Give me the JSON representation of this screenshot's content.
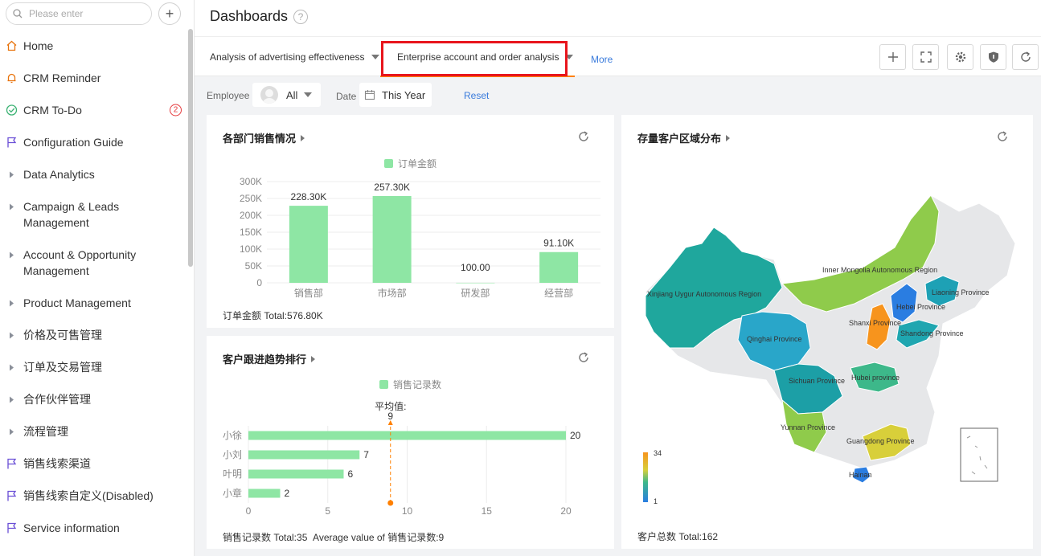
{
  "sidebar": {
    "search_placeholder": "Please enter",
    "items": [
      {
        "label": "Home",
        "icon": "home-icon"
      },
      {
        "label": "CRM Reminder",
        "icon": "bell-icon"
      },
      {
        "label": "CRM To-Do",
        "icon": "check-circle-icon",
        "badge": "2"
      },
      {
        "label": "Configuration Guide",
        "icon": "flag-icon"
      },
      {
        "label": "Data Analytics",
        "icon": "caret-right-icon"
      },
      {
        "label": "Campaign & Leads Management",
        "icon": "caret-right-icon"
      },
      {
        "label": "Account & Opportunity Management",
        "icon": "caret-right-icon"
      },
      {
        "label": "Product Management",
        "icon": "caret-right-icon"
      },
      {
        "label": "价格及可售管理",
        "icon": "caret-right-icon"
      },
      {
        "label": "订单及交易管理",
        "icon": "caret-right-icon"
      },
      {
        "label": "合作伙伴管理",
        "icon": "caret-right-icon"
      },
      {
        "label": "流程管理",
        "icon": "caret-right-icon"
      },
      {
        "label": "销售线索渠道",
        "icon": "flag-icon"
      },
      {
        "label": "销售线索自定义(Disabled)",
        "icon": "flag-icon"
      },
      {
        "label": "Service information",
        "icon": "flag-icon"
      }
    ]
  },
  "header": {
    "title": "Dashboards",
    "help": "?"
  },
  "tabs": [
    {
      "label": "Analysis of advertising effectiveness"
    },
    {
      "label": "Enterprise account and order analysis"
    }
  ],
  "more_label": "More",
  "toolbar_icons": [
    "plus-icon",
    "fullscreen-icon",
    "settings-icon",
    "shield-icon",
    "refresh-icon"
  ],
  "filters": {
    "employee_label": "Employee",
    "employee_value": "All",
    "date_label": "Date",
    "date_value": "This Year",
    "reset_label": "Reset"
  },
  "colors": {
    "bar": "#8ee6a4",
    "accent": "#ff8000",
    "link": "#3a7bdc",
    "highlight": "#e8151c"
  },
  "chart_data": [
    {
      "type": "bar",
      "title": "各部门销售情况",
      "legend": "订单金额",
      "categories": [
        "销售部",
        "市场部",
        "研发部",
        "经营部"
      ],
      "values": [
        228300,
        257300,
        100,
        91100
      ],
      "data_labels": [
        "228.30K",
        "257.30K",
        "100.00",
        "91.10K"
      ],
      "y_ticks": [
        "0",
        "50K",
        "100K",
        "150K",
        "200K",
        "250K",
        "300K"
      ],
      "ylim": [
        0,
        300000
      ],
      "footer": "订单金额 Total:576.80K"
    },
    {
      "type": "bar",
      "orientation": "horizontal",
      "title": "客户跟进趋势排行",
      "legend": "销售记录数",
      "categories": [
        "小徐",
        "小刘",
        "叶明",
        "小章"
      ],
      "values": [
        20,
        7,
        6,
        2
      ],
      "x_ticks": [
        "0",
        "5",
        "10",
        "15",
        "20"
      ],
      "xlim": [
        0,
        20
      ],
      "average_label": "平均值:",
      "average_value": 9,
      "average_display": "9",
      "footer_total": "销售记录数 Total:35",
      "footer_avg": "Average value of 销售记录数:9"
    },
    {
      "type": "map",
      "title": "存量客户区域分布",
      "scale_min": "1",
      "scale_max": "34",
      "regions": [
        "Inner Mongolia Autonomous Region",
        "Xinjiang Uygur Autonomous Region",
        "Liaoning Province",
        "Hebei Province",
        "Shanxi Province",
        "Shandong Province",
        "Qinghai Province",
        "Sichuan Province",
        "Hubei province",
        "Yunnan Province",
        "Guangdong Province",
        "Hainan"
      ],
      "footer": "客户总数 Total:162"
    }
  ]
}
